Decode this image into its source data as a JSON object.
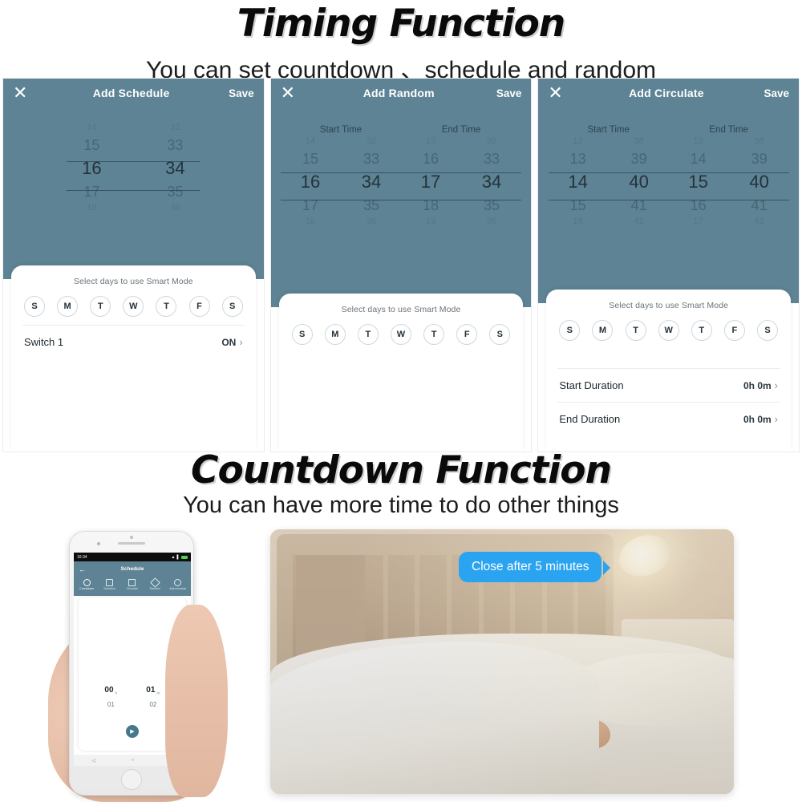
{
  "sections": {
    "timing": {
      "title": "Timing Function",
      "subtitle": "You can set countdown 、schedule and random"
    },
    "countdown": {
      "title": "Countdown Function",
      "subtitle": "You can have more time to do other things"
    }
  },
  "screens": [
    {
      "close_icon": "✕",
      "title": "Add Schedule",
      "save_label": "Save",
      "picker_headers": [],
      "wheels": [
        {
          "ghost_top": "14",
          "prev": "15",
          "selected": "16",
          "next": "17",
          "ghost_bottom": "18"
        },
        {
          "ghost_top": "32",
          "prev": "33",
          "selected": "34",
          "next": "35",
          "ghost_bottom": "36"
        }
      ],
      "card_title": "Select days to use Smart Mode",
      "days": [
        "S",
        "M",
        "T",
        "W",
        "T",
        "F",
        "S"
      ],
      "rows": [
        {
          "label": "Switch 1",
          "value": "ON",
          "chevron": "›"
        }
      ]
    },
    {
      "close_icon": "✕",
      "title": "Add Random",
      "save_label": "Save",
      "picker_headers": [
        "Start Time",
        "End Time"
      ],
      "wheels": [
        {
          "ghost_top": "14",
          "prev": "15",
          "selected": "16",
          "next": "17",
          "ghost_bottom": "18"
        },
        {
          "ghost_top": "32",
          "prev": "33",
          "selected": "34",
          "next": "35",
          "ghost_bottom": "36"
        },
        {
          "ghost_top": "15",
          "prev": "16",
          "selected": "17",
          "next": "18",
          "ghost_bottom": "19"
        },
        {
          "ghost_top": "32",
          "prev": "33",
          "selected": "34",
          "next": "35",
          "ghost_bottom": "36"
        }
      ],
      "card_title": "Select days to use Smart Mode",
      "days": [
        "S",
        "M",
        "T",
        "W",
        "T",
        "F",
        "S"
      ],
      "rows": []
    },
    {
      "close_icon": "✕",
      "title": "Add Circulate",
      "save_label": "Save",
      "picker_headers": [
        "Start Time",
        "End Time"
      ],
      "wheels": [
        {
          "ghost_top": "12",
          "prev": "13",
          "selected": "14",
          "next": "15",
          "ghost_bottom": "16"
        },
        {
          "ghost_top": "38",
          "prev": "39",
          "selected": "40",
          "next": "41",
          "ghost_bottom": "42"
        },
        {
          "ghost_top": "13",
          "prev": "14",
          "selected": "15",
          "next": "16",
          "ghost_bottom": "17"
        },
        {
          "ghost_top": "38",
          "prev": "39",
          "selected": "40",
          "next": "41",
          "ghost_bottom": "42"
        }
      ],
      "card_title": "Select days to use Smart Mode",
      "days": [
        "S",
        "M",
        "T",
        "W",
        "T",
        "F",
        "S"
      ],
      "rows": [
        {
          "label": "Start Duration",
          "value": "0h 0m",
          "chevron": "›"
        },
        {
          "label": "End Duration",
          "value": "0h 0m",
          "chevron": "›"
        }
      ]
    }
  ],
  "phone": {
    "status_time": "16:34",
    "back_icon": "←",
    "screen_title": "Schedule",
    "tabs": [
      {
        "label": "Countdown",
        "icon": "clock-icon",
        "active": true
      },
      {
        "label": "Schedule",
        "icon": "calendar-icon",
        "active": false
      },
      {
        "label": "Circulate",
        "icon": "hourglass-icon",
        "active": false
      },
      {
        "label": "Random",
        "icon": "dice-icon",
        "active": false
      },
      {
        "label": "Astronomical",
        "icon": "sun-icon",
        "active": false
      }
    ],
    "countdown": {
      "hours_selected": "00",
      "hours_unit": "h",
      "hours_next": "01",
      "minutes_selected": "01",
      "minutes_unit": "m",
      "minutes_next": "02"
    },
    "play_icon": "▶",
    "sys_nav": [
      "◁",
      "○",
      "□"
    ]
  },
  "photo": {
    "bubble_text": "Close after 5 minutes"
  },
  "colors": {
    "teal": "#5d8394",
    "bubble_blue": "#2aa4f0",
    "heading_black": "#0a0a0a"
  }
}
